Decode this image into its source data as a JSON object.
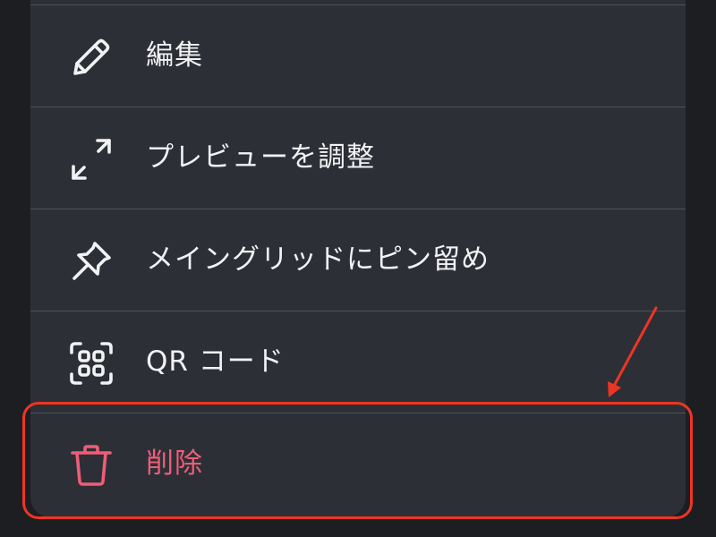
{
  "menu": {
    "items": [
      {
        "label": "編集",
        "icon": "pencil-icon"
      },
      {
        "label": "プレビューを調整",
        "icon": "expand-corners-icon"
      },
      {
        "label": "メイングリッドにピン留め",
        "icon": "pin-icon"
      },
      {
        "label": "QR コード",
        "icon": "qr-code-icon"
      },
      {
        "label": "削除",
        "icon": "trash-icon",
        "destructive": true
      }
    ]
  },
  "colors": {
    "background": "#1d1e22",
    "sheet": "#2c2f36",
    "divider": "#4e525c",
    "text": "#f2f2f4",
    "destructive": "#ef5d78",
    "annotation": "#ee3523"
  }
}
